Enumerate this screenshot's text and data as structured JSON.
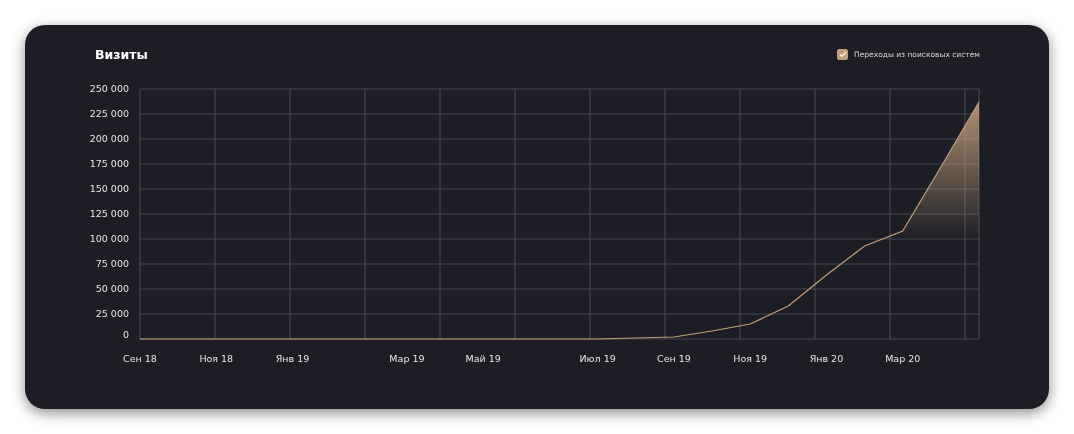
{
  "card": {
    "title": "Визиты",
    "legend": {
      "checked": true
    },
    "chart_data": {
      "type": "area",
      "categories": [
        "Сен 18",
        null,
        "Ноя 18",
        null,
        "Янв 19",
        null,
        null,
        "Мар 19",
        null,
        "Май 19",
        null,
        null,
        "Июл 19",
        null,
        "Сен 19",
        null,
        "Ноя 19",
        null,
        "Янв 20",
        null,
        "Мар 20",
        null,
        null
      ],
      "series": [
        {
          "name": "Переходы из поисковых систем",
          "color": "#c29f7d",
          "values": [
            0,
            0,
            0,
            0,
            0,
            0,
            0,
            0,
            0,
            0,
            0,
            0,
            0,
            1000,
            2000,
            8000,
            15000,
            33000,
            64000,
            93000,
            108000,
            172000,
            237000
          ]
        }
      ],
      "ylim": [
        0,
        250000
      ],
      "grid": true,
      "yticks": [
        {
          "value": 0,
          "label": "0"
        },
        {
          "value": 25000,
          "label": "25 000"
        },
        {
          "value": 50000,
          "label": "50 000"
        },
        {
          "value": 75000,
          "label": "75 000"
        },
        {
          "value": 100000,
          "label": "100 000"
        },
        {
          "value": 125000,
          "label": "125 000"
        },
        {
          "value": 150000,
          "label": "150 000"
        },
        {
          "value": 175000,
          "label": "175 000"
        },
        {
          "value": 200000,
          "label": "200 000"
        },
        {
          "value": 225000,
          "label": "225 000"
        },
        {
          "value": 250000,
          "label": "250 000"
        }
      ]
    }
  }
}
